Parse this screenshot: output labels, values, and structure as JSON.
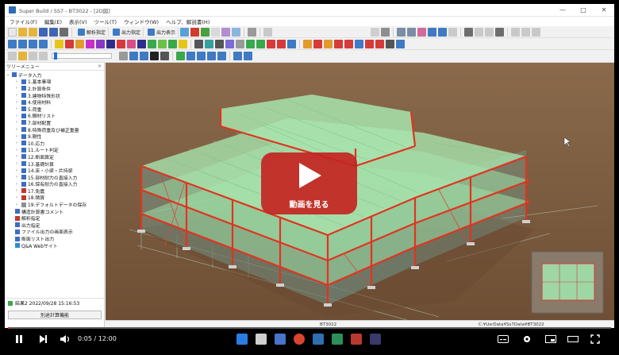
{
  "window": {
    "title": "Super Build / SS7 - BT3022 - [2D図]",
    "minimize": "—",
    "maximize": "□",
    "close": "✕"
  },
  "menu": [
    "ファイル(F)",
    "編集(E)",
    "表示(V)",
    "ツール(T)",
    "ウィンドウ(W)",
    "ヘルプ、解説書(H)"
  ],
  "toolbar": {
    "buttons": [
      {
        "label": "解析指定",
        "color": "#3f7ac4"
      },
      {
        "label": "出力指定",
        "color": "#3f7ac4"
      },
      {
        "label": "出力表示",
        "color": "#3f7ac4"
      }
    ]
  },
  "sidebar": {
    "header": "ツリーメニュー",
    "close": "×",
    "root": "データ入力",
    "items": [
      {
        "label": "1.基本事項",
        "color": "#3b6dc4"
      },
      {
        "label": "2.計算条件",
        "color": "#3b6dc4"
      },
      {
        "label": "3.建物特殊形状",
        "color": "#3b6dc4"
      },
      {
        "label": "4.使用材料",
        "color": "#3b6dc4"
      },
      {
        "label": "5.荷重",
        "color": "#3b6dc4"
      },
      {
        "label": "6.鋼材リスト",
        "color": "#3b6dc4"
      },
      {
        "label": "7.部材配置",
        "color": "#3b6dc4"
      },
      {
        "label": "8.特殊荷重及び補正重量",
        "color": "#3b6dc4"
      },
      {
        "label": "9.剛性",
        "color": "#3b6dc4"
      },
      {
        "label": "10.応力",
        "color": "#3b6dc4"
      },
      {
        "label": "11.ルート判定",
        "color": "#3b6dc4"
      },
      {
        "label": "12.断面算定",
        "color": "#3b6dc4"
      },
      {
        "label": "13.基礎計算",
        "color": "#3b6dc4"
      },
      {
        "label": "14.床・小梁・片持梁",
        "color": "#3b6dc4"
      },
      {
        "label": "15.部材耐力の直接入力",
        "color": "#3b6dc4"
      },
      {
        "label": "16.保有耐力の直接入力",
        "color": "#3b6dc4"
      },
      {
        "label": "17.免震",
        "color": "#c0392b"
      },
      {
        "label": "18.積算",
        "color": "#c0392b"
      },
      {
        "label": "19.デフォルトデータの保存",
        "color": "#8e8e8e"
      }
    ],
    "extra": [
      {
        "label": "構造計算書コメント",
        "color": "#3b6dc4"
      },
      {
        "label": "解析指定",
        "color": "#c0392b"
      },
      {
        "label": "出力指定",
        "color": "#3b6dc4"
      },
      {
        "label": "ファイル出力の画面表示",
        "color": "#3b6dc4"
      },
      {
        "label": "断面リスト出力",
        "color": "#3b6dc4"
      },
      {
        "label": "Q&A Webサイト",
        "color": "#2f8bd8"
      }
    ],
    "status": "結果2  2022/09/28 15:16:53",
    "button": "別途計算機能"
  },
  "statusbar": {
    "left": "BT3022",
    "right": "C:¥UsrData¥Ss7Data¥BT3022"
  },
  "video": {
    "play_label": "動画を見る",
    "time": "0:05 / 12:00",
    "progress_fraction": 0.004
  },
  "colors": {
    "frame": "#e0341f",
    "deck": "#9fe0a8",
    "ground": "#7b5a3d",
    "play": "#c42622"
  }
}
